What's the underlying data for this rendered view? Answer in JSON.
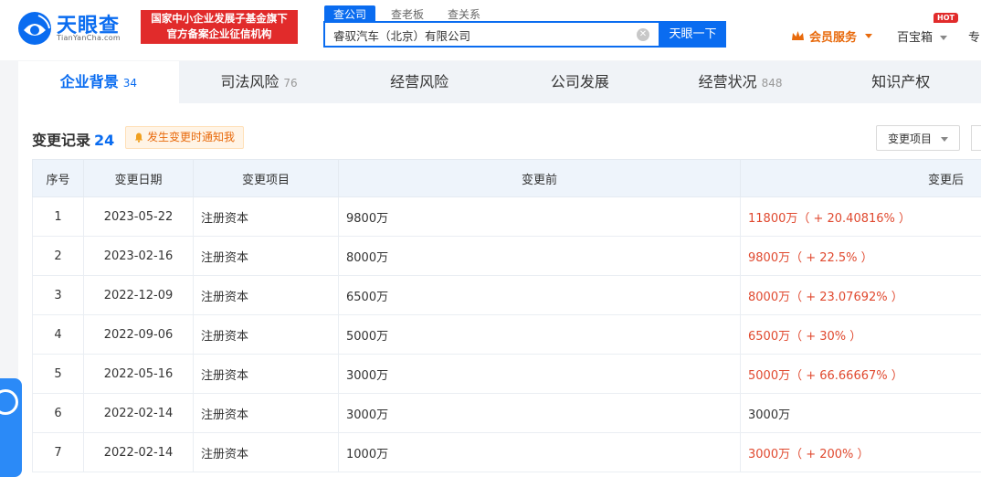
{
  "header": {
    "logo_text": "天眼查",
    "logo_sub": "TianYanCha.com",
    "badge_line1": "国家中小企业发展子基金旗下",
    "badge_line2": "官方备案企业征信机构",
    "search_tabs": [
      "查公司",
      "查老板",
      "查关系"
    ],
    "search_value": "睿驭汽车（北京）有限公司",
    "search_button": "天眼一下",
    "member_label": "会员服务",
    "baobox_label": "百宝箱",
    "hot_label": "HOT",
    "more_label": "专"
  },
  "tabs": [
    {
      "label": "企业背景",
      "count": "34"
    },
    {
      "label": "司法风险",
      "count": "76"
    },
    {
      "label": "经营风险",
      "count": ""
    },
    {
      "label": "公司发展",
      "count": ""
    },
    {
      "label": "经营状况",
      "count": "848"
    },
    {
      "label": "知识产权",
      "count": ""
    }
  ],
  "section": {
    "title": "变更记录",
    "count": "24",
    "notify_label": "发生变更时通知我",
    "filter_label": "变更项目"
  },
  "table": {
    "headers": [
      "序号",
      "变更日期",
      "变更项目",
      "变更前",
      "变更后"
    ],
    "rows": [
      {
        "no": "1",
        "date": "2023-05-22",
        "item": "注册资本",
        "before": "9800万",
        "after": "11800万（ + 20.40816% ）",
        "after_red": true
      },
      {
        "no": "2",
        "date": "2023-02-16",
        "item": "注册资本",
        "before": "8000万",
        "after": "9800万（ + 22.5% ）",
        "after_red": true
      },
      {
        "no": "3",
        "date": "2022-12-09",
        "item": "注册资本",
        "before": "6500万",
        "after": "8000万（ + 23.07692% ）",
        "after_red": true
      },
      {
        "no": "4",
        "date": "2022-09-06",
        "item": "注册资本",
        "before": "5000万",
        "after": "6500万（ + 30% ）",
        "after_red": true
      },
      {
        "no": "5",
        "date": "2022-05-16",
        "item": "注册资本",
        "before": "3000万",
        "after": "5000万（ + 66.66667% ）",
        "after_red": true
      },
      {
        "no": "6",
        "date": "2022-02-14",
        "item": "注册资本",
        "before": "3000万",
        "after": "3000万",
        "after_red": false
      },
      {
        "no": "7",
        "date": "2022-02-14",
        "item": "注册资本",
        "before": "1000万",
        "after": "3000万（ + 200% ）",
        "after_red": true
      }
    ]
  },
  "colors": {
    "brand_blue": "#0a6cf0",
    "badge_red": "#e12b2b",
    "increase_red": "#e0492f",
    "member_orange": "#e86a0c"
  },
  "icons": {
    "logo": "tianyancha-eye-logo-icon",
    "clear": "clear-circle-icon",
    "member": "crown-icon",
    "notify": "bell-icon",
    "dropdown": "caret-down-icon",
    "float": "customer-service-icon"
  }
}
